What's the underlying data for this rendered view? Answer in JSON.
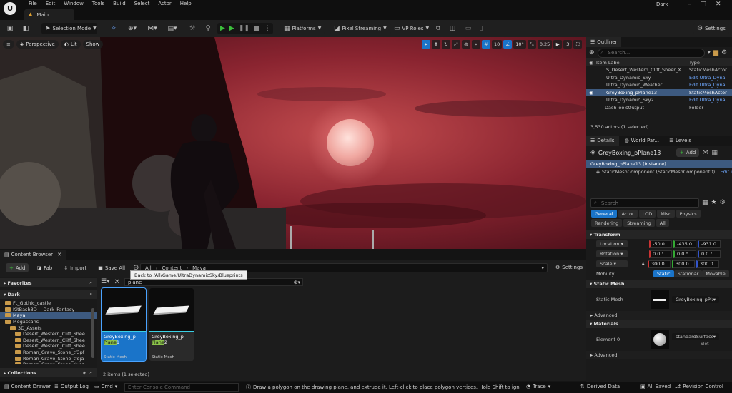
{
  "menu": [
    "File",
    "Edit",
    "Window",
    "Tools",
    "Build",
    "Select",
    "Actor",
    "Help"
  ],
  "tab_main": "Main",
  "project_name": "Dark",
  "toolbar": {
    "selection_mode": "Selection Mode",
    "platforms": "Platforms",
    "pixel_streaming": "Pixel Streaming",
    "vp_roles": "VP Roles",
    "settings": "Settings"
  },
  "viewport": {
    "perspective": "Perspective",
    "lit": "Lit",
    "show": "Show",
    "grid_snap": "10",
    "rot_snap": "10°",
    "scale_snap": "0.25",
    "camera_speed": "3"
  },
  "outliner": {
    "title": "Outliner",
    "search_placeholder": "Search...",
    "col_label": "Item Label",
    "col_type": "Type",
    "rows": [
      {
        "label": "S_Desert_Western_Cliff_Sheer_X",
        "type": "StaticMeshActor",
        "link": false,
        "selected": false
      },
      {
        "label": "Ultra_Dynamic_Sky",
        "type": "Edit Ultra_Dyna",
        "link": true,
        "selected": false
      },
      {
        "label": "Ultra_Dynamic_Weather",
        "type": "Edit Ultra_Dyna",
        "link": true,
        "selected": false
      },
      {
        "label": "GreyBoxing_pPlane13",
        "type": "StaticMeshActor",
        "link": false,
        "selected": true
      },
      {
        "label": "Ultra_Dynamic_Sky2",
        "type": "Edit Ultra_Dyna",
        "link": true,
        "selected": false
      },
      {
        "label": "DashToolsOutput",
        "type": "Folder",
        "link": false,
        "selected": false
      }
    ],
    "count": "3,530 actors (1 selected)"
  },
  "details": {
    "tabs": [
      "Details",
      "World Par...",
      "Levels"
    ],
    "actor_name": "GreyBoxing_pPlane13",
    "add_label": "Add",
    "instance": "GreyBoxing_pPlane13 (Instance)",
    "component": "StaticMeshComponent (StaticMeshComponent0)",
    "component_link": "Edit i",
    "search_placeholder": "Search",
    "filters_row1": [
      "General",
      "Actor",
      "LOD",
      "Misc",
      "Physics"
    ],
    "filters_row2": [
      "Rendering",
      "Streaming",
      "All"
    ],
    "transform": {
      "title": "Transform",
      "location_label": "Location",
      "location": [
        "-50.0",
        "-435.0",
        "-931.0"
      ],
      "rotation_label": "Rotation",
      "rotation": [
        "0.0 °",
        "0.0 °",
        "0.0 °"
      ],
      "scale_label": "Scale",
      "scale": [
        "300.0",
        "300.0",
        "300.0"
      ],
      "mobility_label": "Mobility",
      "mobility": [
        "Static",
        "Stationar",
        "Movable"
      ]
    },
    "static_mesh": {
      "title": "Static Mesh",
      "label": "Static Mesh",
      "value": "GreyBoxing_pPlane"
    },
    "advanced": "Advanced",
    "materials": {
      "title": "Materials",
      "element": "Element 0",
      "value": "standardSurface1",
      "slot": "Slot"
    }
  },
  "content_browser": {
    "tab": "Content Browser",
    "add": "Add",
    "fab": "Fab",
    "import": "Import",
    "save_all": "Save All",
    "breadcrumb": [
      "All",
      "Content",
      "Maya"
    ],
    "settings": "Settings",
    "tooltip": "Back to /All/Game/UltraDynamicSky/Blueprints",
    "search_value": "plane",
    "favorites": "Favorites",
    "root": "Dark",
    "tree": [
      {
        "label": "Ft_Gothic_castle",
        "indent": 1,
        "selected": false
      },
      {
        "label": "KitBash3D_-_Dark_Fantasy",
        "indent": 1,
        "selected": false
      },
      {
        "label": "Maya",
        "indent": 1,
        "selected": true
      },
      {
        "label": "Megascans",
        "indent": 1,
        "selected": false
      },
      {
        "label": "3D_Assets",
        "indent": 2,
        "selected": false
      },
      {
        "label": "Desert_Western_Cliff_Shee",
        "indent": 3,
        "selected": false
      },
      {
        "label": "Desert_Western_Cliff_Shee",
        "indent": 3,
        "selected": false
      },
      {
        "label": "Desert_Western_Cliff_Shee",
        "indent": 3,
        "selected": false
      },
      {
        "label": "Roman_Grave_Stone_tf3pf",
        "indent": 3,
        "selected": false
      },
      {
        "label": "Roman_Grave_Stone_tfdja",
        "indent": 3,
        "selected": false
      },
      {
        "label": "Roman_Grave_Stone_tiuss",
        "indent": 3,
        "selected": false
      }
    ],
    "collections": "Collections",
    "assets": [
      {
        "name_a": "GreyBoxing_p",
        "name_b": "Plane1",
        "hl": "Plane",
        "rest": "1",
        "type": "Static Mesh",
        "selected": true
      },
      {
        "name_a": "GreyBoxing_p",
        "name_b": "Plane2",
        "hl": "Plane",
        "rest": "2",
        "type": "Static Mesh",
        "selected": false
      }
    ],
    "item_count": "2 items (1 selected)"
  },
  "statusbar": {
    "content_drawer": "Content Drawer",
    "output_log": "Output Log",
    "cmd": "Cmd",
    "console_placeholder": "Enter Console Command",
    "hint": "Draw a polygon on the drawing plane, and extrude it. Left-click to place polygon vertices. Hold Shift to ignore snapping w",
    "trace": "Trace",
    "derived_data": "Derived Data",
    "all_saved": "All Saved",
    "revision_control": "Revision Control"
  },
  "colors": {
    "accent_blue": "#1a74c9",
    "selection": "#3d5a80",
    "play_green": "#3cbf3c",
    "folder": "#c99a4a"
  }
}
